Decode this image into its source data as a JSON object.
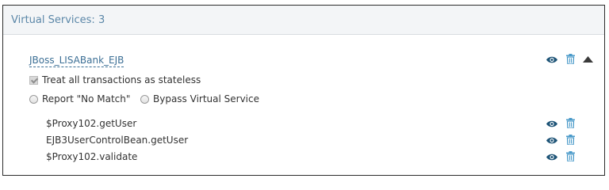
{
  "header": {
    "title": "Virtual Services: 3"
  },
  "service": {
    "name": "JBoss_LISABank_EJB",
    "stateless_label": "Treat all transactions as stateless",
    "stateless_checked": true,
    "radio_options": [
      {
        "label": "Report \"No Match\"",
        "selected": false
      },
      {
        "label": "Bypass Virtual Service",
        "selected": false
      }
    ],
    "operations": [
      {
        "name": "$Proxy102.getUser"
      },
      {
        "name": "EJB3UserControlBean.getUser"
      },
      {
        "name": "$Proxy102.validate"
      }
    ]
  },
  "icons": [
    "eye-icon",
    "trash-icon",
    "collapse-caret-icon"
  ],
  "colors": {
    "header_text": "#5b87a8",
    "link": "#3c6f95",
    "eye": "#1e5477",
    "trash": "#4a9ac9"
  }
}
